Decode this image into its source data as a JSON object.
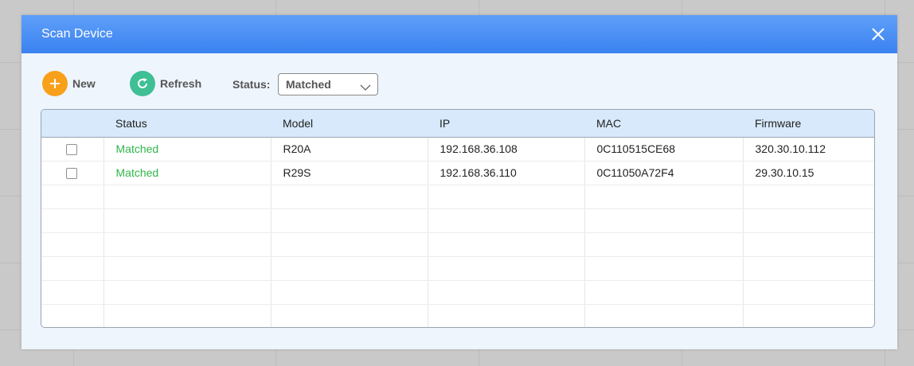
{
  "dialog": {
    "title": "Scan Device"
  },
  "toolbar": {
    "new_label": "New",
    "refresh_label": "Refresh",
    "status_label": "Status:",
    "status_value": "Matched"
  },
  "table": {
    "headers": [
      "",
      "Status",
      "Model",
      "IP",
      "MAC",
      "Firmware"
    ],
    "rows": [
      {
        "status": "Matched",
        "model": "R20A",
        "ip": "192.168.36.108",
        "mac": "0C110515CE68",
        "firmware": "320.30.10.112"
      },
      {
        "status": "Matched",
        "model": "R29S",
        "ip": "192.168.36.110",
        "mac": "0C11050A72F4",
        "firmware": "29.30.10.15"
      }
    ]
  },
  "colors": {
    "titlebar": "#3b82f1",
    "new_button": "#f9a01b",
    "refresh_button": "#3fbf94",
    "matched_status": "#2fb64a",
    "header_row": "#d7e9fb"
  }
}
